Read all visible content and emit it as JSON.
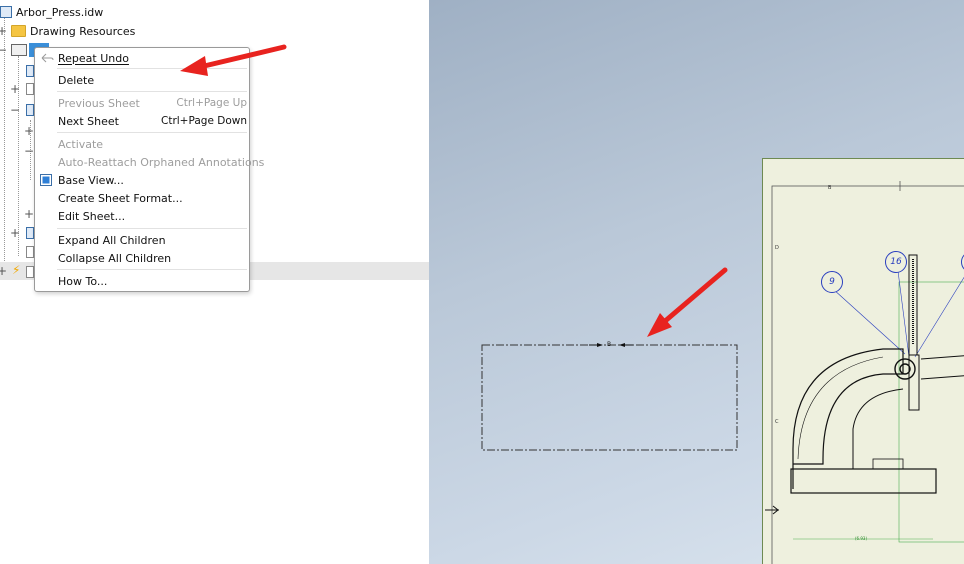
{
  "browser": {
    "root_label": "Arbor_Press.idw",
    "drawing_resources": "Drawing Resources",
    "expanders": [
      "+",
      "−",
      "+",
      "−",
      "+",
      "−",
      "+",
      "+",
      "+"
    ]
  },
  "context_menu": {
    "items": [
      {
        "label": "Repeat Undo",
        "enabled": true,
        "icon": "repeat-undo-icon"
      },
      {
        "label": "Delete",
        "enabled": true
      },
      {
        "label": "Previous Sheet",
        "shortcut": "Ctrl+Page Up",
        "enabled": false
      },
      {
        "label": "Next Sheet",
        "shortcut": "Ctrl+Page Down",
        "enabled": true
      },
      {
        "label": "Activate",
        "enabled": false
      },
      {
        "label": "Auto-Reattach Orphaned Annotations",
        "enabled": false
      },
      {
        "label": "Base View...",
        "enabled": true,
        "icon": "base-view-icon"
      },
      {
        "label": "Create Sheet Format...",
        "enabled": true
      },
      {
        "label": "Edit Sheet...",
        "enabled": true
      },
      {
        "label": "Expand All Children",
        "enabled": true
      },
      {
        "label": "Collapse All Children",
        "enabled": true
      },
      {
        "label": "How To...",
        "enabled": true
      }
    ]
  },
  "canvas": {
    "view_label": "B",
    "balloons": [
      "16",
      "9"
    ],
    "zone_labels": [
      "B",
      "D",
      "C"
    ],
    "dimension": "(6.93)"
  },
  "colors": {
    "arrow": "#e8231f",
    "balloon": "#2a3fbf",
    "sheet_bg": "#eef0de",
    "dimension": "#2a8a2a"
  }
}
